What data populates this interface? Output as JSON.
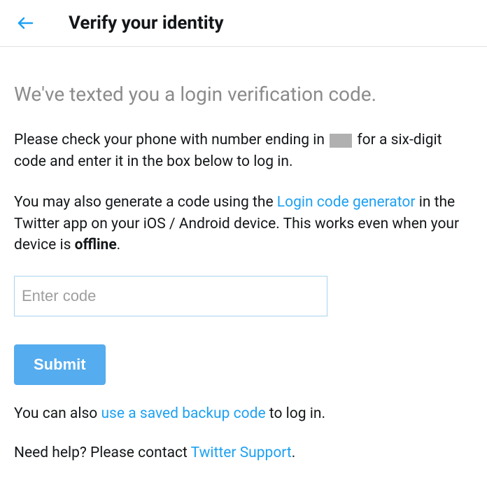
{
  "header": {
    "title": "Verify your identity"
  },
  "main": {
    "heading": "We've texted you a login verification code.",
    "instruction_part1": "Please check your phone with number ending in ",
    "instruction_part2": " for a six-digit code and enter it in the box below to log in.",
    "generator_part1": "You may also generate a code using the ",
    "generator_link": "Login code generator",
    "generator_part2": " in the Twitter app on your iOS / Android device. This works even when your device is ",
    "generator_bold": "offline",
    "generator_part3": ".",
    "input_placeholder": "Enter code",
    "submit_label": "Submit",
    "backup_part1": "You can also ",
    "backup_link": "use a saved backup code",
    "backup_part2": " to log in.",
    "help_part1": "Need help? Please contact ",
    "help_link": "Twitter Support",
    "help_part2": "."
  }
}
